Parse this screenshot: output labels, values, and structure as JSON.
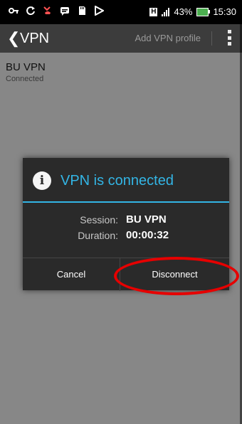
{
  "status_bar": {
    "icons_left": [
      "key-icon",
      "sync-icon",
      "missed-call-icon",
      "message-icon",
      "sd-card-icon",
      "play-store-icon"
    ],
    "network_badge": "H",
    "battery_percent": "43%",
    "time": "15:30",
    "battery_color": "#4caf50"
  },
  "action_bar": {
    "back_glyph": "❮",
    "title": "VPN",
    "add_profile": "Add VPN profile"
  },
  "vpn_list": [
    {
      "name": "BU VPN",
      "status": "Connected"
    }
  ],
  "dialog": {
    "title": "VPN is connected",
    "session_label": "Session:",
    "session_value": "BU VPN",
    "duration_label": "Duration:",
    "duration_value": "00:00:32",
    "cancel": "Cancel",
    "disconnect": "Disconnect",
    "accent_color": "#33b5e5"
  },
  "annotation": {
    "highlight_color": "#e60000"
  }
}
